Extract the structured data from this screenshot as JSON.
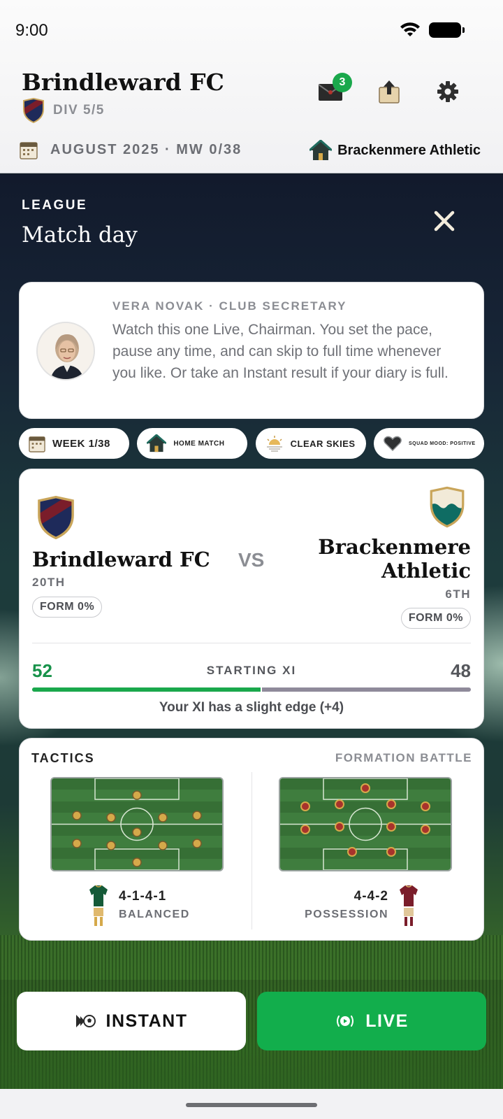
{
  "status_bar": {
    "time": "9:00"
  },
  "header": {
    "club_name": "Brindleward FC",
    "division": "DIV 5/5",
    "inbox_badge": "3",
    "date_label": "AUGUST 2025 · MW 0/38",
    "opponent_label": "Brackenmere Athletic"
  },
  "icons": {
    "inbox": "envelope-icon",
    "transfer": "upload-box-icon",
    "settings": "gear-icon",
    "calendar": "calendar-icon",
    "home": "house-icon",
    "close": "close-icon"
  },
  "screen": {
    "category": "LEAGUE",
    "title": "Match day"
  },
  "message": {
    "from": "VERA NOVAK · CLUB SECRETARY",
    "text": "Watch this one Live, Chairman. You set the pace, pause any time, and can skip to full time whenever you like. Or take an Instant result if your diary is full."
  },
  "chips": [
    {
      "label": "WEEK 1/38",
      "icon": "calendar-icon"
    },
    {
      "label": "HOME MATCH",
      "icon": "house-icon"
    },
    {
      "label": "CLEAR SKIES",
      "icon": "sunrise-icon"
    },
    {
      "label": "SQUAD MOOD: POSITIVE",
      "icon": "heart-icon"
    }
  ],
  "match": {
    "home": {
      "name": "Brindleward FC",
      "position": "20TH",
      "form": "FORM 0%"
    },
    "vs_label": "VS",
    "away": {
      "name": "Brackenmere Athletic",
      "position": "6TH",
      "form": "FORM 0%"
    },
    "starting_xi": {
      "label": "STARTING XI",
      "home_rating": "52",
      "away_rating": "48",
      "home_share": 0.52,
      "note": "Your XI has a slight edge (+4)"
    }
  },
  "tactics": {
    "title": "TACTICS",
    "subtitle": "FORMATION BATTLE",
    "home": {
      "formation": "4-1-4-1",
      "style": "BALANCED"
    },
    "away": {
      "formation": "4-4-2",
      "style": "POSSESSION"
    }
  },
  "actions": {
    "instant": "INSTANT",
    "live": "LIVE"
  },
  "colors": {
    "accent_green": "#12ae4c",
    "home_primary": "#1e2a5a",
    "home_secondary": "#7a1d2a",
    "away_primary": "#0f6c63"
  }
}
